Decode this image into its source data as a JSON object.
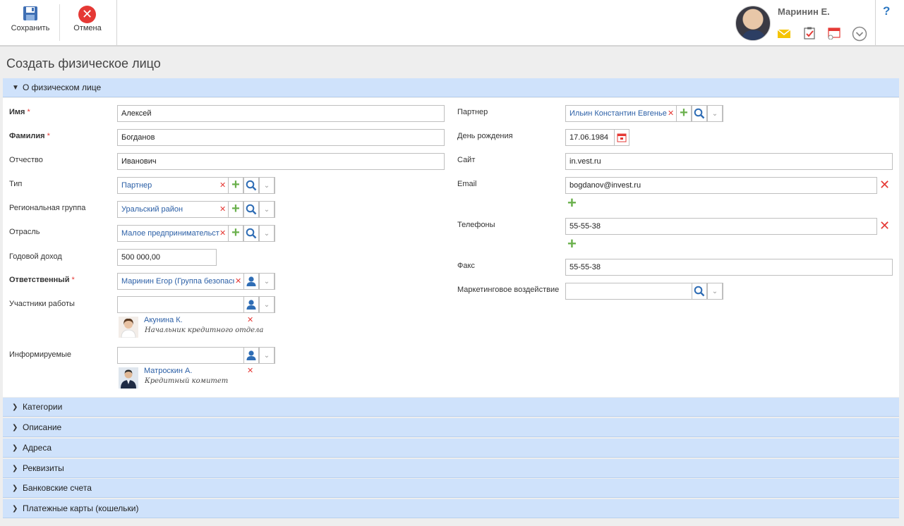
{
  "toolbar": {
    "save_label": "Сохранить",
    "cancel_label": "Отмена"
  },
  "user": {
    "name": "Маринин Е."
  },
  "help_label": "?",
  "page_title": "Создать физическое лицо",
  "section_main": "О физическом лице",
  "left_fields": {
    "first_name": {
      "label": "Имя",
      "value": "Алексей"
    },
    "last_name": {
      "label": "Фамилия",
      "value": "Богданов"
    },
    "middle_name": {
      "label": "Отчество",
      "value": "Иванович"
    },
    "type": {
      "label": "Тип",
      "value": "Партнер"
    },
    "region": {
      "label": "Региональная группа",
      "value": "Уральский район"
    },
    "industry": {
      "label": "Отрасль",
      "value": "Малое предпринимательство"
    },
    "income": {
      "label": "Годовой доход",
      "value": "500 000,00"
    },
    "responsible": {
      "label": "Ответственный",
      "value": "Маринин Егор (Группа безопасности)"
    },
    "participants": {
      "label": "Участники работы",
      "person": {
        "name": "Акунина К.",
        "role": "Начальник кредитного отдела"
      }
    },
    "informed": {
      "label": "Информируемые",
      "person": {
        "name": "Матроскин А.",
        "role": "Кредитный комитет"
      }
    }
  },
  "right_fields": {
    "partner": {
      "label": "Партнер",
      "value": "Ильин Константин Евгеньевич"
    },
    "birthday": {
      "label": "День рождения",
      "value": "17.06.1984"
    },
    "site": {
      "label": "Сайт",
      "value": "in.vest.ru"
    },
    "email": {
      "label": "Email",
      "value": "bogdanov@invest.ru"
    },
    "phones": {
      "label": "Телефоны",
      "value": "55-55-38"
    },
    "fax": {
      "label": "Факс",
      "value": "55-55-38"
    },
    "marketing": {
      "label": "Маркетинговое воздействие",
      "value": ""
    }
  },
  "sections": [
    "Категории",
    "Описание",
    "Адреса",
    "Реквизиты",
    "Банковские счета",
    "Платежные карты (кошельки)"
  ],
  "required_mark": "*",
  "colors": {
    "accent_blue": "#2b5fa6",
    "section_bg": "#cfe2fb",
    "delete_red": "#e53935",
    "add_green": "#6ab04c"
  }
}
